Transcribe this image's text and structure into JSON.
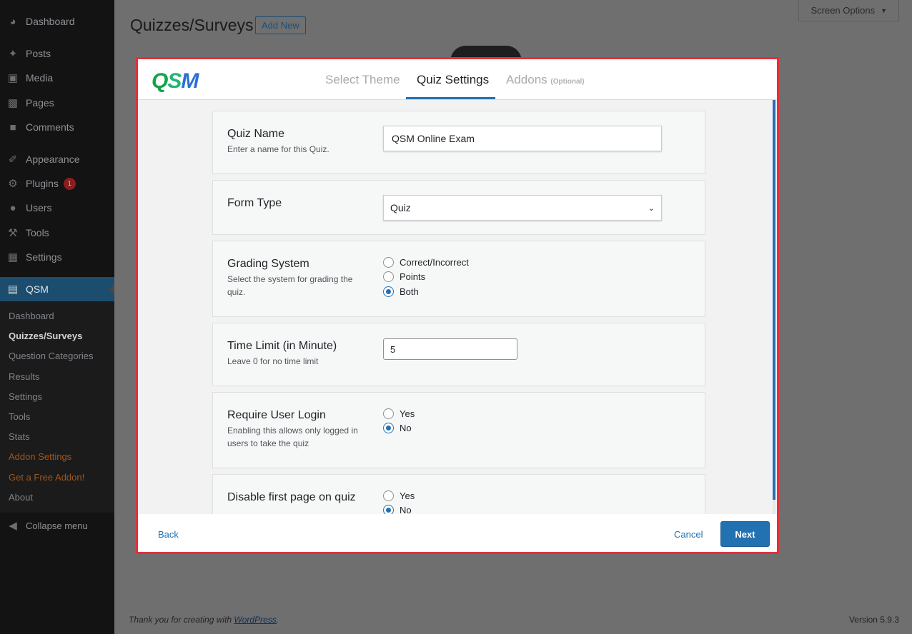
{
  "sidebar": {
    "items": [
      {
        "label": "Dashboard",
        "icon": "dashboard-icon"
      },
      {
        "label": "Posts",
        "icon": "pin-icon"
      },
      {
        "label": "Media",
        "icon": "media-icon"
      },
      {
        "label": "Pages",
        "icon": "pages-icon"
      },
      {
        "label": "Comments",
        "icon": "comments-icon"
      },
      {
        "label": "Appearance",
        "icon": "brush-icon"
      },
      {
        "label": "Plugins",
        "icon": "plug-icon",
        "badge": "1"
      },
      {
        "label": "Users",
        "icon": "user-icon"
      },
      {
        "label": "Tools",
        "icon": "wrench-icon"
      },
      {
        "label": "Settings",
        "icon": "sliders-icon"
      },
      {
        "label": "QSM",
        "icon": "qsm-icon"
      }
    ],
    "submenu": [
      "Dashboard",
      "Quizzes/Surveys",
      "Question Categories",
      "Results",
      "Settings",
      "Tools",
      "Stats",
      "Addon Settings",
      "Get a Free Addon!",
      "About"
    ],
    "collapse_label": "Collapse menu"
  },
  "header": {
    "title": "Quizzes/Surveys",
    "add_new": "Add New",
    "screen_options": "Screen Options"
  },
  "modal": {
    "logo": {
      "q": "Q",
      "s": "S",
      "m": "M"
    },
    "tabs": [
      {
        "label": "Select Theme"
      },
      {
        "label": "Quiz Settings"
      },
      {
        "label": "Addons",
        "suffix": "(Optional)"
      }
    ],
    "fields": {
      "quiz_name": {
        "label": "Quiz Name",
        "desc": "Enter a name for this Quiz.",
        "value": "QSM Online Exam"
      },
      "form_type": {
        "label": "Form Type",
        "value": "Quiz"
      },
      "grading": {
        "label": "Grading System",
        "desc": "Select the system for grading the quiz.",
        "options": [
          "Correct/Incorrect",
          "Points",
          "Both"
        ],
        "selected": "Both"
      },
      "time_limit": {
        "label": "Time Limit (in Minute)",
        "desc": "Leave 0 for no time limit",
        "value": "5"
      },
      "require_login": {
        "label": "Require User Login",
        "desc": "Enabling this allows only logged in users to take the quiz",
        "options": [
          "Yes",
          "No"
        ],
        "selected": "No"
      },
      "disable_first_page": {
        "label": "Disable first page on quiz",
        "options": [
          "Yes",
          "No"
        ],
        "selected": "No"
      }
    },
    "footer": {
      "back": "Back",
      "cancel": "Cancel",
      "next": "Next"
    }
  },
  "footer": {
    "thanks_prefix": "Thank you for creating with ",
    "thanks_link": "WordPress",
    "thanks_suffix": ".",
    "version": "Version 5.9.3"
  },
  "colors": {
    "accent": "#2271b1",
    "modal_border": "#e3303a",
    "sidebar_bg": "#131313"
  }
}
